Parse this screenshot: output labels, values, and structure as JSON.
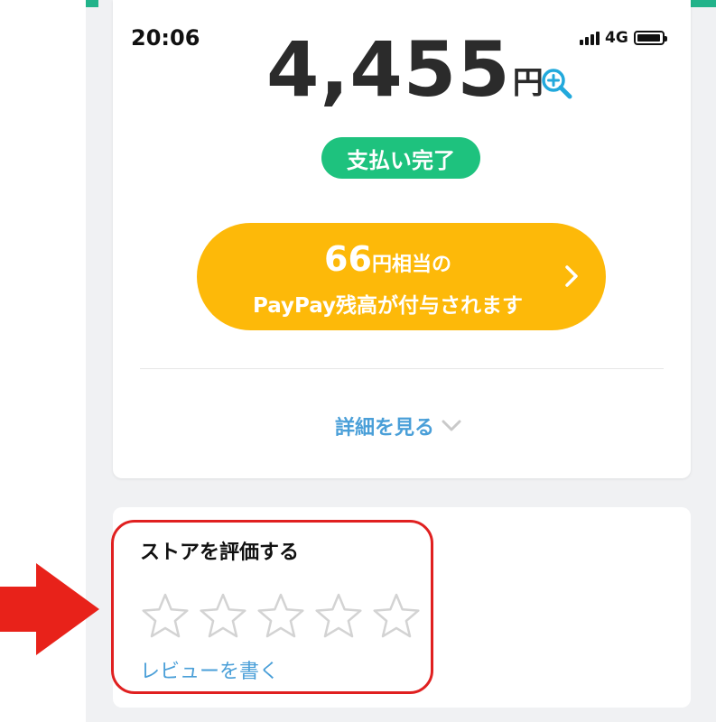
{
  "status_bar": {
    "time": "20:06",
    "network": "4G"
  },
  "payment": {
    "amount": "4,455",
    "currency": "円",
    "status_label": "支払い完了"
  },
  "bonus": {
    "amount": "66",
    "suffix": "円相当の",
    "message": "PayPay残高が付与されます"
  },
  "details": {
    "label": "詳細を見る"
  },
  "review": {
    "title": "ストアを評価する",
    "rating": 0,
    "max_rating": 5,
    "write_label": "レビューを書く"
  },
  "colors": {
    "brand_teal": "#22b38a",
    "status_green": "#1ec27e",
    "bonus_yellow": "#fdb909",
    "link_blue": "#4a9fd8",
    "annotation_red": "#e02020"
  }
}
